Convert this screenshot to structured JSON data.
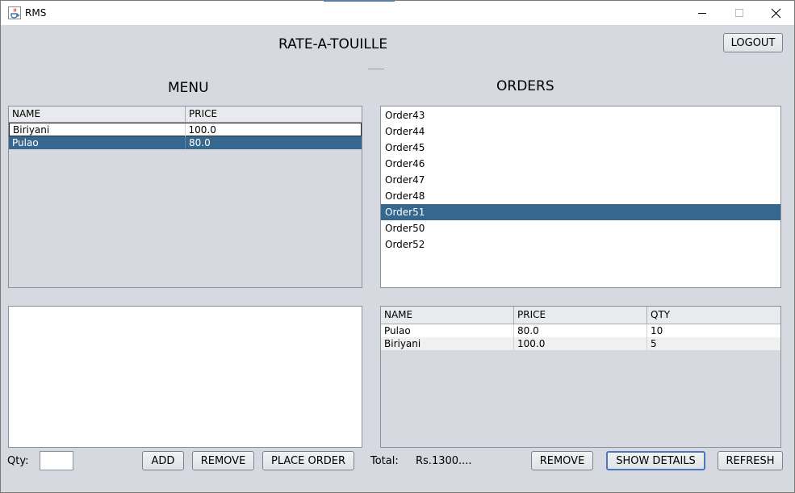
{
  "window": {
    "title": "RMS",
    "app_icon": "java-cup-icon",
    "controls": {
      "minimize": "minimize-icon",
      "maximize": "maximize-icon",
      "close": "close-icon"
    }
  },
  "header": {
    "title": "RATE-A-TOUILLE",
    "logout_label": "LOGOUT"
  },
  "menu": {
    "heading": "MENU",
    "columns": [
      "NAME",
      "PRICE"
    ],
    "rows": [
      {
        "name": "Biriyani",
        "price": "100.0"
      },
      {
        "name": "Pulao",
        "price": "80.0"
      }
    ],
    "selected_index": 1
  },
  "orders": {
    "heading": "ORDERS",
    "items": [
      "Order43",
      "Order44",
      "Order45",
      "Order46",
      "Order47",
      "Order48",
      "Order51",
      "Order50",
      "Order52"
    ],
    "selected_index": 6
  },
  "order_details": {
    "columns": [
      "NAME",
      "PRICE",
      "QTY"
    ],
    "rows": [
      {
        "name": "Pulao",
        "price": "80.0",
        "qty": "10"
      },
      {
        "name": "Biriyani",
        "price": "100.0",
        "qty": "5"
      }
    ]
  },
  "footer_left": {
    "qty_label": "Qty:",
    "qty_value": "",
    "add_label": "ADD",
    "remove_label": "REMOVE",
    "place_order_label": "PLACE ORDER"
  },
  "footer_right": {
    "total_label": "Total:",
    "total_value": "Rs.1300....",
    "remove_label": "REMOVE",
    "show_details_label": "SHOW DETAILS",
    "refresh_label": "REFRESH"
  },
  "colors": {
    "selection": "#36678f",
    "background": "#d6d9df",
    "accent": "#4b78b8"
  }
}
